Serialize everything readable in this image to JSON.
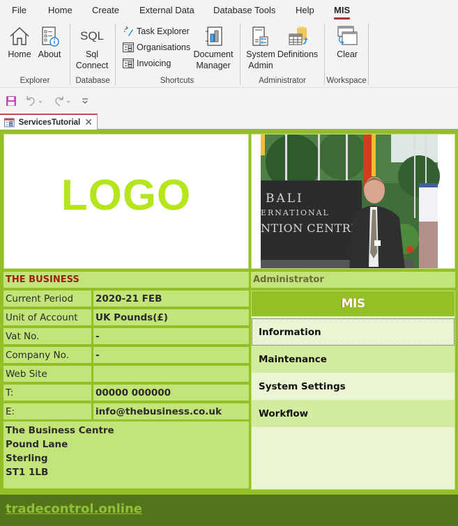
{
  "menubar": {
    "items": [
      {
        "label": "File"
      },
      {
        "label": "Home"
      },
      {
        "label": "Create"
      },
      {
        "label": "External Data"
      },
      {
        "label": "Database Tools"
      },
      {
        "label": "Help"
      },
      {
        "label": "MIS",
        "active": true
      }
    ]
  },
  "ribbon": {
    "groups": {
      "explorer": {
        "label": "Explorer",
        "buttons": {
          "home": "Home",
          "about": "About"
        }
      },
      "database": {
        "label": "Database",
        "buttons": {
          "sql_icon_text": "SQL",
          "sql_line1": "Sql",
          "sql_line2": "Connect"
        }
      },
      "shortcuts": {
        "label": "Shortcuts",
        "buttons": {
          "task_explorer": "Task Explorer",
          "organisations": "Organisations",
          "invoicing": "Invoicing",
          "doc_line1": "Document",
          "doc_line2": "Manager"
        }
      },
      "administrator": {
        "label": "Administrator",
        "buttons": {
          "sysadmin_line1": "System",
          "sysadmin_line2": "Admin",
          "definitions": "Definitions"
        }
      },
      "workspace": {
        "label": "Workspace",
        "buttons": {
          "clear": "Clear"
        }
      }
    }
  },
  "qat": {
    "save_icon": "save-icon",
    "undo_icon": "undo-icon",
    "redo_icon": "redo-icon",
    "customize_icon": "customize-qat-icon"
  },
  "document_tab": {
    "label": "ServicesTutorial",
    "close_glyph": "✕"
  },
  "form": {
    "logo_text": "LOGO",
    "photo_sign": {
      "line1": "BALI",
      "line2": "ERNATIONAL",
      "line3": "NTION CENTRE"
    },
    "business": {
      "title": "THE BUSINESS",
      "rows": [
        {
          "label": "Current Period",
          "value": "2020-21 FEB"
        },
        {
          "label": "Unit of Account",
          "value": "UK Pounds(£)"
        },
        {
          "label": "Vat No.",
          "value": "-"
        },
        {
          "label": "Company No.",
          "value": "-"
        },
        {
          "label": "Web Site",
          "value": ""
        },
        {
          "label": "T:",
          "value": "00000 000000"
        },
        {
          "label": "E:",
          "value": "info@thebusiness.co.uk"
        }
      ],
      "address": [
        "The Business Centre",
        "Pound Lane",
        "Sterling",
        "ST1 1LB"
      ]
    },
    "user_role": "Administrator",
    "menu": {
      "title": "MIS",
      "items": [
        {
          "label": "Information"
        },
        {
          "label": "Maintenance"
        },
        {
          "label": "System Settings"
        },
        {
          "label": "Workflow"
        }
      ]
    },
    "footer_link": "tradecontrol.online"
  },
  "colors": {
    "form_green": "#92c026",
    "cell_green": "#c2e478",
    "footer_green": "#55731b",
    "title_red": "#9a1e16",
    "logo_green": "#b5e61d",
    "active_tab_red": "#a4373a"
  }
}
